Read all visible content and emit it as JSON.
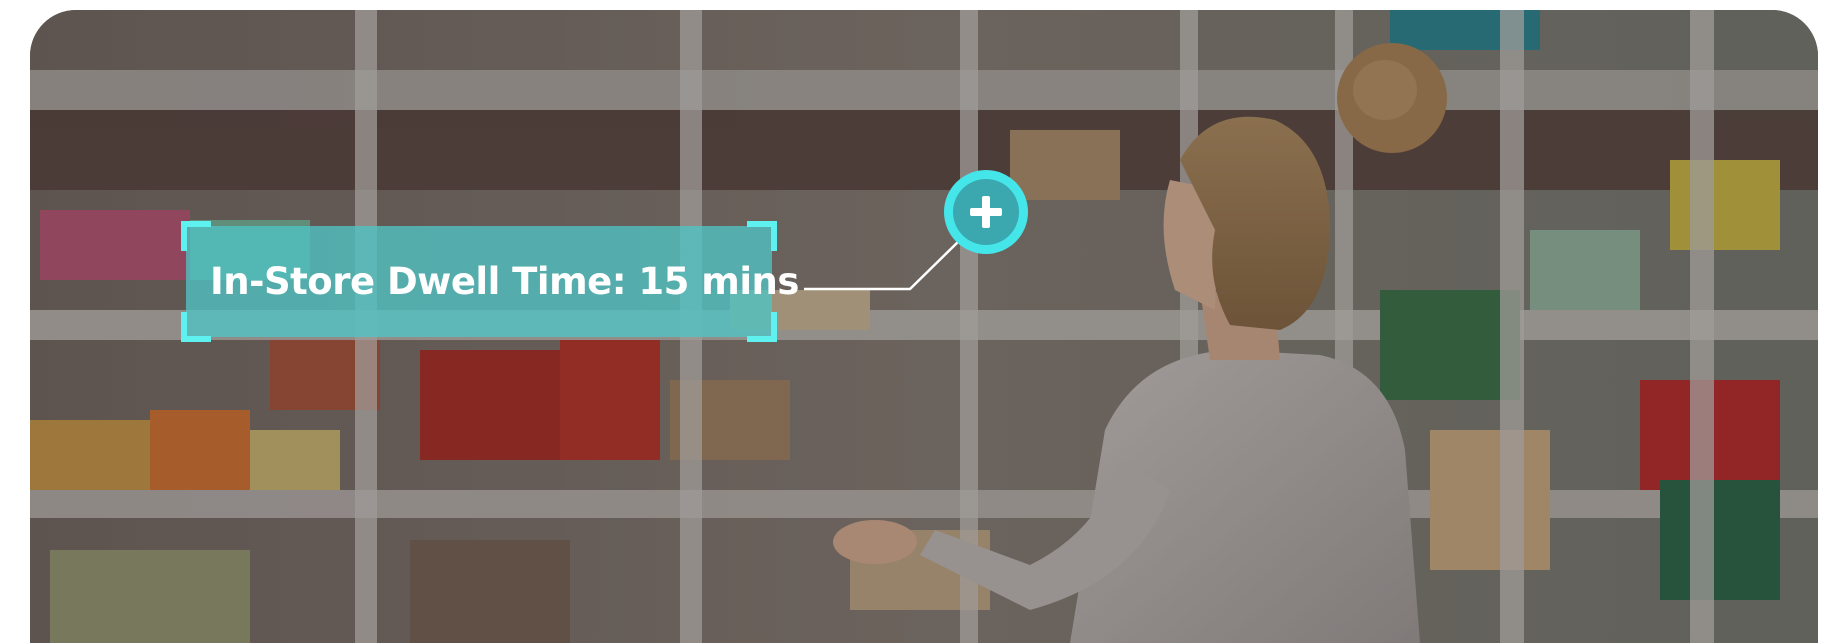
{
  "hotspot": {
    "label": "In-Store Dwell Time: 15 mins",
    "icon": "plus-icon"
  },
  "colors": {
    "accent": "#45e6ea",
    "label_bg": "#4fc4c4",
    "corner": "#5ff0f0",
    "text": "#ffffff"
  }
}
